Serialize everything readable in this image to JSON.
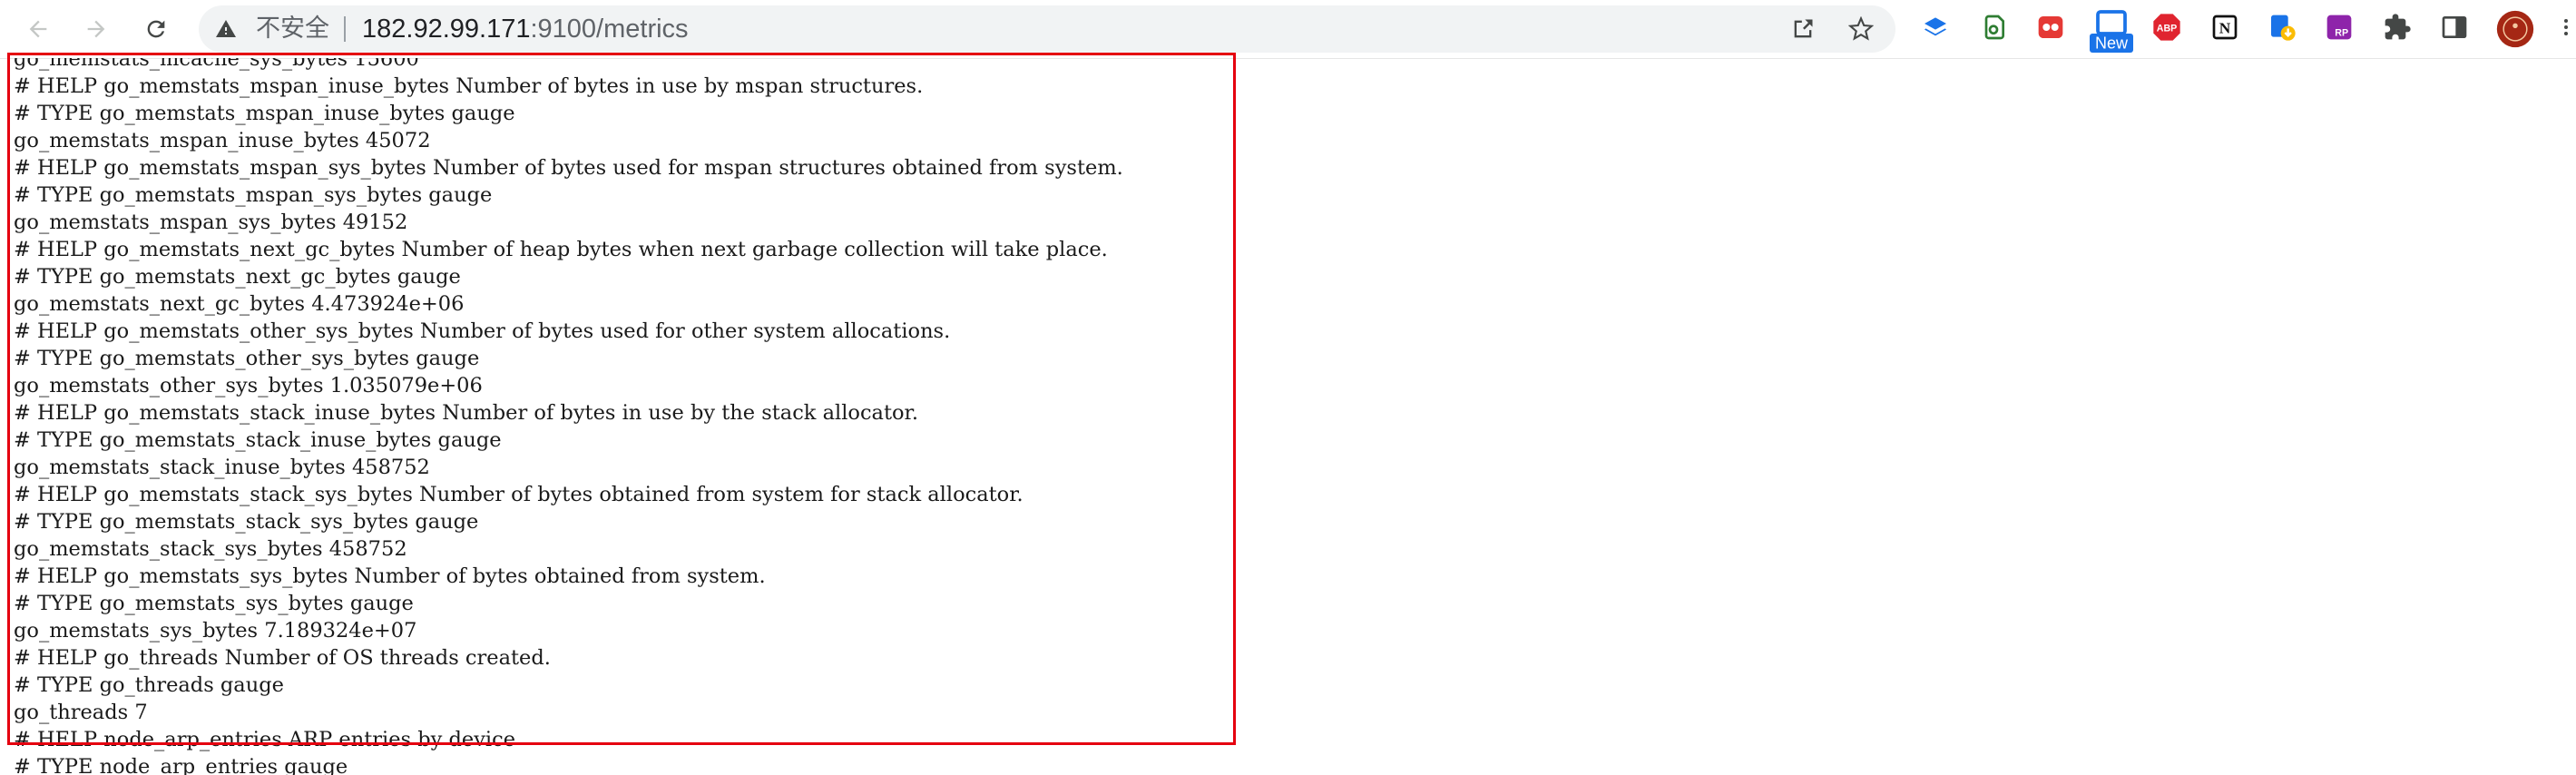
{
  "browser": {
    "security_label": "不安全",
    "url_host": "182.92.99.171",
    "url_rest": ":9100/metrics",
    "icons": {
      "back": "back-arrow-icon",
      "forward": "forward-arrow-icon",
      "reload": "reload-icon",
      "warning": "warning-triangle-icon",
      "share": "share-icon",
      "bookmark": "star-icon"
    },
    "extensions": [
      {
        "name": "layers-extension-icon"
      },
      {
        "name": "evernote-extension-icon"
      },
      {
        "name": "dots-extension-icon"
      },
      {
        "name": "screenshot-new-extension-icon",
        "badge": "New"
      },
      {
        "name": "adblock-plus-extension-icon",
        "label": "ABP"
      },
      {
        "name": "notion-extension-icon",
        "label": "N"
      },
      {
        "name": "download-extension-icon"
      },
      {
        "name": "rp-extension-icon",
        "label": "RP"
      },
      {
        "name": "puzzle-extensions-icon"
      },
      {
        "name": "side-panel-icon"
      },
      {
        "name": "profile-avatar-icon"
      },
      {
        "name": "more-menu-icon"
      }
    ],
    "colors": {
      "accent_blue": "#1a73e8",
      "highlight_red": "#e5000f",
      "abp_red": "#e0242f",
      "new_badge_blue": "#1a73e8"
    }
  },
  "page": {
    "top_partial_line": "go_memstats_mcache_sys_bytes 15600",
    "lines": [
      "# HELP go_memstats_mspan_inuse_bytes Number of bytes in use by mspan structures.",
      "# TYPE go_memstats_mspan_inuse_bytes gauge",
      "go_memstats_mspan_inuse_bytes 45072",
      "# HELP go_memstats_mspan_sys_bytes Number of bytes used for mspan structures obtained from system.",
      "# TYPE go_memstats_mspan_sys_bytes gauge",
      "go_memstats_mspan_sys_bytes 49152",
      "# HELP go_memstats_next_gc_bytes Number of heap bytes when next garbage collection will take place.",
      "# TYPE go_memstats_next_gc_bytes gauge",
      "go_memstats_next_gc_bytes 4.473924e+06",
      "# HELP go_memstats_other_sys_bytes Number of bytes used for other system allocations.",
      "# TYPE go_memstats_other_sys_bytes gauge",
      "go_memstats_other_sys_bytes 1.035079e+06",
      "# HELP go_memstats_stack_inuse_bytes Number of bytes in use by the stack allocator.",
      "# TYPE go_memstats_stack_inuse_bytes gauge",
      "go_memstats_stack_inuse_bytes 458752",
      "# HELP go_memstats_stack_sys_bytes Number of bytes obtained from system for stack allocator.",
      "# TYPE go_memstats_stack_sys_bytes gauge",
      "go_memstats_stack_sys_bytes 458752",
      "# HELP go_memstats_sys_bytes Number of bytes obtained from system.",
      "# TYPE go_memstats_sys_bytes gauge",
      "go_memstats_sys_bytes 7.189324e+07",
      "# HELP go_threads Number of OS threads created.",
      "# TYPE go_threads gauge",
      "go_threads 7",
      "# HELP node_arp_entries ARP entries by device",
      "# TYPE node_arp_entries gauge"
    ]
  }
}
